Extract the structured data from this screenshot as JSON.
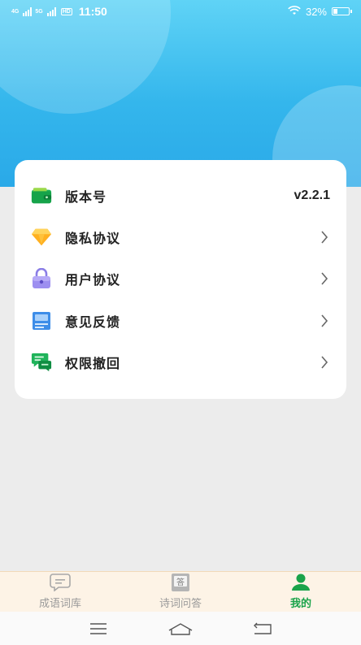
{
  "status_bar": {
    "network1": "4G",
    "network2": "5G",
    "hd": "HD",
    "time": "11:50",
    "battery": "32%"
  },
  "settings": {
    "items": [
      {
        "label": "版本号",
        "value": "v2.2.1",
        "icon": "wallet-icon"
      },
      {
        "label": "隐私协议",
        "icon": "diamond-icon"
      },
      {
        "label": "用户协议",
        "icon": "lock-icon"
      },
      {
        "label": "意见反馈",
        "icon": "feedback-icon"
      },
      {
        "label": "权限撤回",
        "icon": "chat-icon"
      }
    ]
  },
  "tabs": [
    {
      "label": "成语词库",
      "icon": "message-icon",
      "active": false
    },
    {
      "label": "诗词问答",
      "icon": "answer-book-icon",
      "active": false
    },
    {
      "label": "我的",
      "icon": "user-icon",
      "active": true
    }
  ],
  "colors": {
    "header_top": "#5fd3f6",
    "header_bottom": "#2aa9e8",
    "active_tab": "#1aa34a",
    "inactive_tab": "#9a9a9a",
    "tabbar_bg": "#fdf3e6"
  }
}
